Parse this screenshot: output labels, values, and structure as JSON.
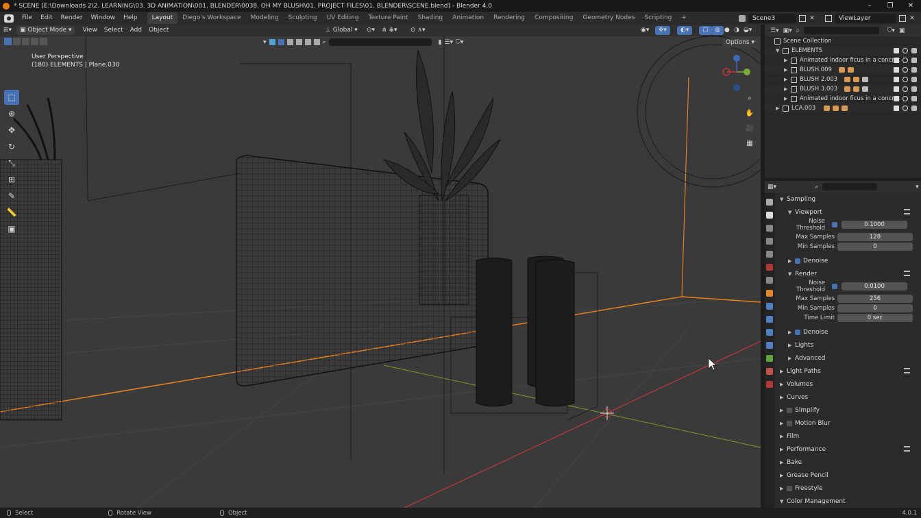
{
  "window": {
    "title": "* SCENE [E:\\Downloads 2\\2. LEARNING\\03. 3D ANIMATION\\001. BLENDER\\0038. OH MY BLUSH\\01. PROJECT FILES\\01. BLENDER\\SCENE.blend] - Blender 4.0",
    "minimize": "–",
    "maximize": "❐",
    "close": "✕"
  },
  "menubar": {
    "menus": [
      "File",
      "Edit",
      "Render",
      "Window",
      "Help"
    ],
    "workspaces": [
      "Layout",
      "Diego's Workspace",
      "Modeling",
      "Sculpting",
      "UV Editing",
      "Texture Paint",
      "Shading",
      "Animation",
      "Rendering",
      "Compositing",
      "Geometry Nodes",
      "Scripting"
    ],
    "add_workspace": "+",
    "scene": "Scene3",
    "view_layer": "ViewLayer"
  },
  "viewport_header": {
    "mode": "Object Mode",
    "menus": [
      "View",
      "Select",
      "Add",
      "Object"
    ],
    "orientation": "Global",
    "options": "Options"
  },
  "viewport": {
    "perspective": "User Perspective",
    "context": "(180) ELEMENTS | Plane.030"
  },
  "tools": [
    "cursor-select",
    "cursor",
    "move",
    "rotate",
    "scale",
    "transform",
    "annotate",
    "measure",
    "add-cube"
  ],
  "outliner": {
    "root": "Scene Collection",
    "items": [
      {
        "label": "ELEMENTS",
        "level": 1,
        "expanded": true
      },
      {
        "label": "Animated indoor ficus in a concret",
        "level": 2
      },
      {
        "label": "BLUSH.009",
        "level": 2
      },
      {
        "label": "BLUSH 2.003",
        "level": 2
      },
      {
        "label": "BLUSH 3.003",
        "level": 2
      },
      {
        "label": "Animated indoor ficus in a concret",
        "level": 2
      },
      {
        "label": "LCA.003",
        "level": 1
      }
    ]
  },
  "properties": {
    "sampling": "Sampling",
    "viewport": {
      "title": "Viewport",
      "noise_threshold_label": "Noise Threshold",
      "noise_threshold": "0.1000",
      "max_samples_label": "Max Samples",
      "max_samples": "128",
      "min_samples_label": "Min Samples",
      "min_samples": "0",
      "denoise": "Denoise"
    },
    "render": {
      "title": "Render",
      "noise_threshold_label": "Noise Threshold",
      "noise_threshold": "0.0100",
      "max_samples_label": "Max Samples",
      "max_samples": "256",
      "min_samples_label": "Min Samples",
      "min_samples": "0",
      "time_limit_label": "Time Limit",
      "time_limit": "0 sec",
      "denoise": "Denoise"
    },
    "lights": "Lights",
    "advanced": "Advanced",
    "sections": [
      "Light Paths",
      "Volumes",
      "Curves",
      "Simplify",
      "Motion Blur",
      "Film",
      "Performance",
      "Bake",
      "Grease Pencil",
      "Freestyle",
      "Color Management"
    ]
  },
  "statusbar": {
    "select": "Select",
    "rotate_view": "Rotate View",
    "object": "Object",
    "version": "4.0.1"
  },
  "colors": {
    "accent": "#4772b3",
    "x_axis": "#c2343d",
    "y_axis": "#7d9b2c",
    "selection_orange": "#e8811f"
  }
}
